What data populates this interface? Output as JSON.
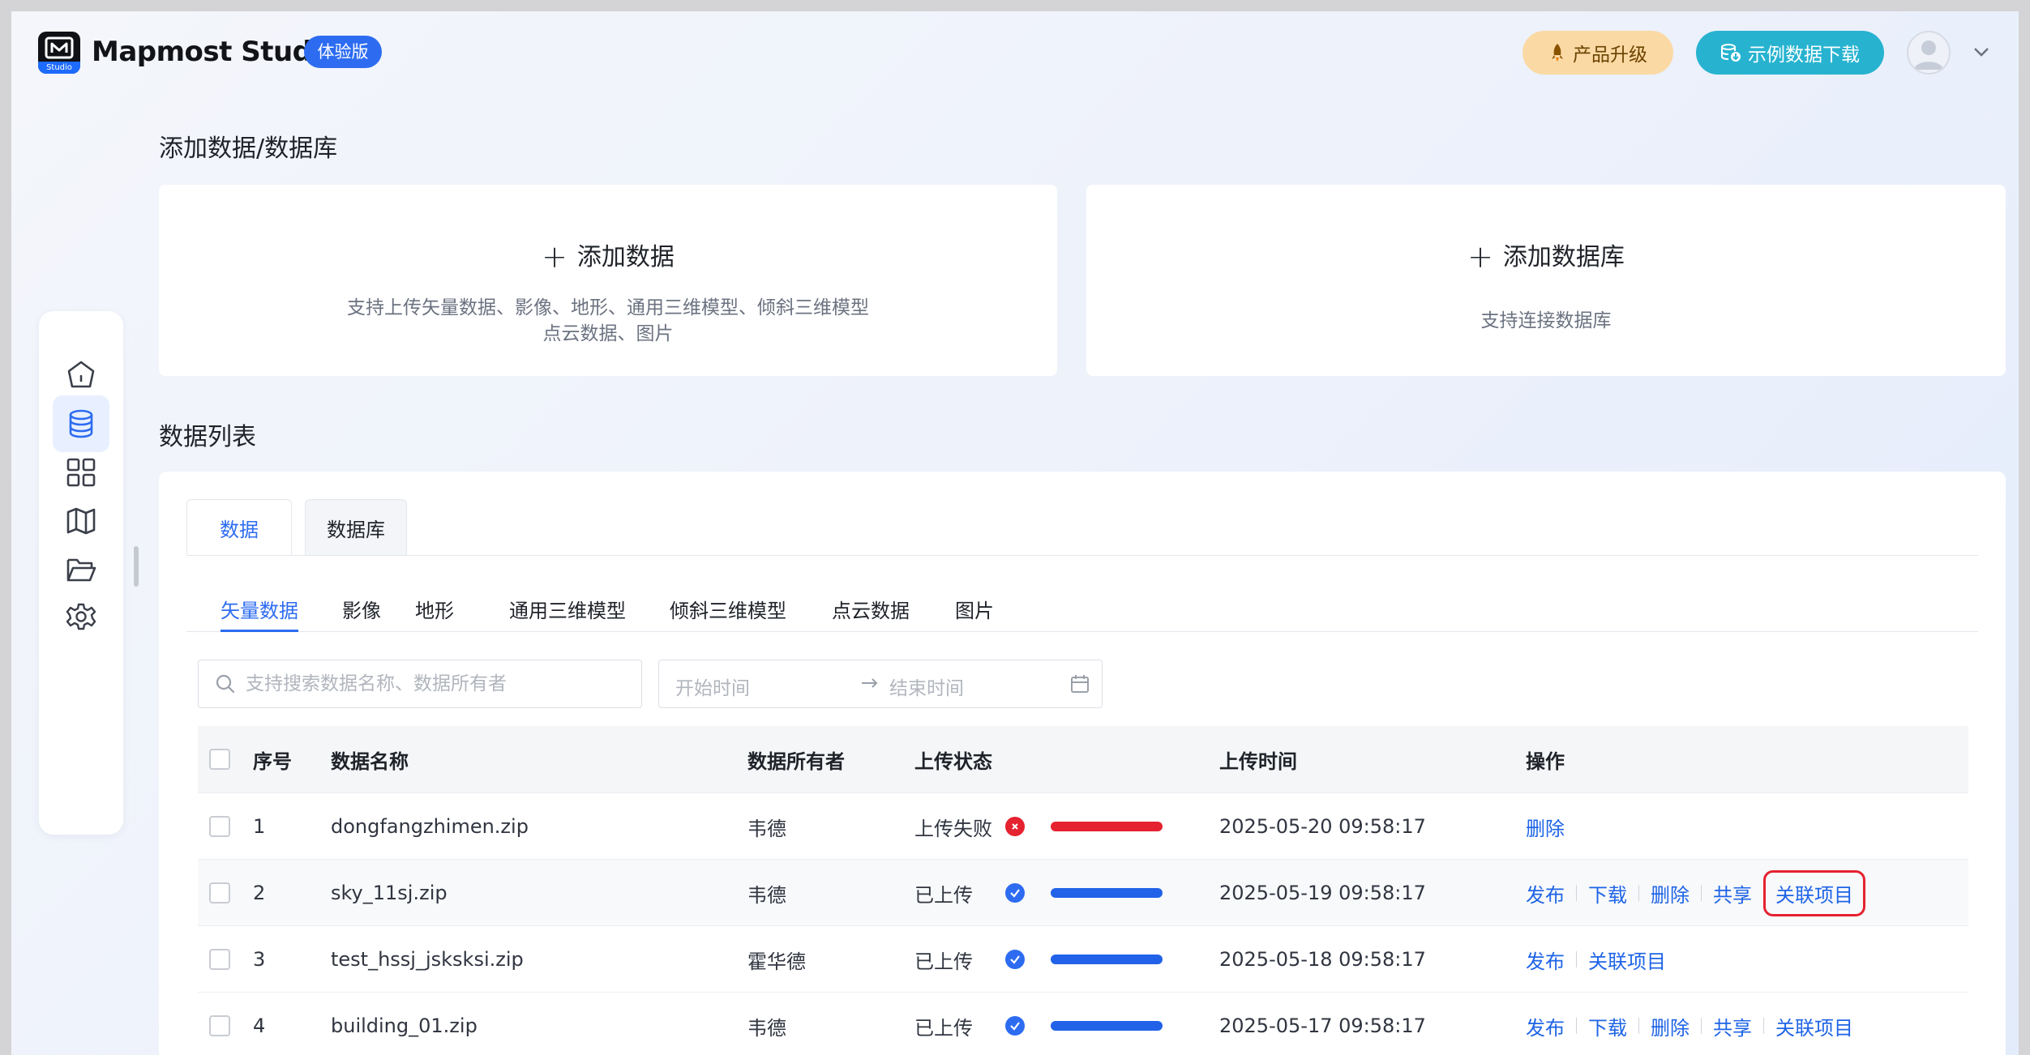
{
  "header": {
    "brand": "Mapmost Studio",
    "logo_sub": "Studio",
    "trial_badge": "体验版",
    "upgrade_label": "产品升级",
    "sample_download_label": "示例数据下载"
  },
  "add_section": {
    "title": "添加数据/数据库",
    "add_data": {
      "label": "添加数据",
      "desc_line1": "支持上传矢量数据、影像、地形、通用三维模型、倾斜三维模型",
      "desc_line2": "点云数据、图片"
    },
    "add_db": {
      "label": "添加数据库",
      "desc": "支持连接数据库"
    }
  },
  "list_section": {
    "title": "数据列表",
    "tabs": [
      "数据",
      "数据库"
    ],
    "subtabs": [
      "矢量数据",
      "影像",
      "地形",
      "通用三维模型",
      "倾斜三维模型",
      "点云数据",
      "图片"
    ],
    "search_placeholder": "支持搜索数据名称、数据所有者",
    "date_start_placeholder": "开始时间",
    "date_end_placeholder": "结束时间",
    "columns": {
      "index": "序号",
      "name": "数据名称",
      "owner": "数据所有者",
      "status": "上传状态",
      "time": "上传时间",
      "actions": "操作"
    },
    "rows": [
      {
        "index": "1",
        "name": "dongfangzhimen.zip",
        "owner": "韦德",
        "status": "上传失败",
        "time": "2025-05-20 09:58:17",
        "actions": [
          "删除"
        ]
      },
      {
        "index": "2",
        "name": "sky_11sj.zip",
        "owner": "韦德",
        "status": "已上传",
        "time": "2025-05-19 09:58:17",
        "actions": [
          "发布",
          "下载",
          "删除",
          "共享",
          "关联项目"
        ]
      },
      {
        "index": "3",
        "name": "test_hssj_jsksksi.zip",
        "owner": "霍华德",
        "status": "已上传",
        "time": "2025-05-18 09:58:17",
        "actions": [
          "发布",
          "关联项目"
        ]
      },
      {
        "index": "4",
        "name": "building_01.zip",
        "owner": "韦德",
        "status": "已上传",
        "time": "2025-05-17 09:58:17",
        "actions": [
          "发布",
          "下载",
          "删除",
          "共享",
          "关联项目"
        ]
      }
    ]
  },
  "sidebar": {
    "icons": [
      "home-icon",
      "database-icon",
      "apps-grid-icon",
      "map-icon",
      "folder-icon",
      "settings-icon"
    ],
    "active": "database-icon"
  },
  "colors": {
    "primary": "#2d6cf1",
    "error": "#e5222f",
    "upgrade_bg": "#fbd9a4",
    "sample_bg": "#27b3d0"
  }
}
